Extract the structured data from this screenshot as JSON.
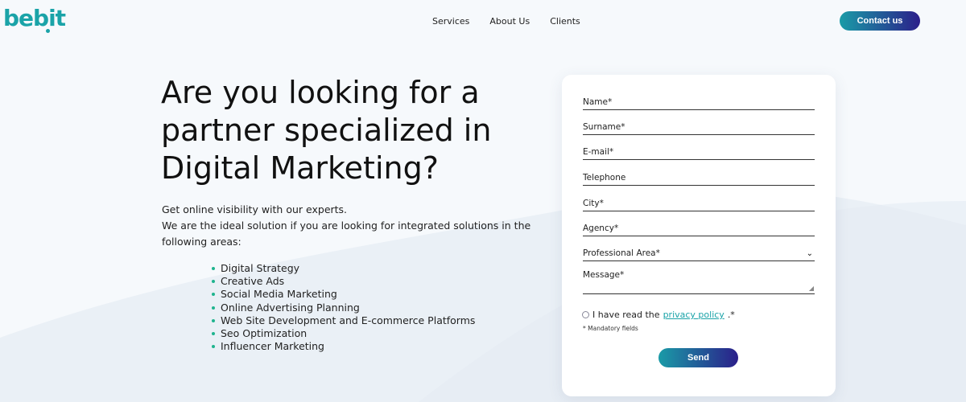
{
  "header": {
    "logo_text": "bebit",
    "nav": [
      "Services",
      "About Us",
      "Clients"
    ],
    "contact_label": "Contact us"
  },
  "hero": {
    "title": "Are you looking for a partner specialized in Digital Marketing?",
    "line1": "Get online visibility with our experts.",
    "line2": "We are the ideal solution if you are looking for integrated solutions in the following areas:",
    "bullets": [
      "Digital Strategy",
      "Creative Ads",
      "Social Media Marketing",
      "Online Advertising Planning",
      "Web Site Development and E-commerce Platforms",
      "Seo Optimization",
      "Influencer Marketing"
    ]
  },
  "form": {
    "name": "Name*",
    "surname": "Surname*",
    "email": "E-mail*",
    "telephone": "Telephone",
    "city": "City*",
    "agency": "Agency*",
    "professional_area": "Professional Area*",
    "message": "Message*",
    "privacy_prefix": "I have read the",
    "privacy_link": "privacy policy",
    "privacy_suffix": ".*",
    "mandatory": "* Mandatory fields",
    "send_label": "Send"
  },
  "colors": {
    "accent_teal": "#1aa3a8",
    "bullet_green": "#1fb48e",
    "gradient_end": "#2b1f8a"
  }
}
